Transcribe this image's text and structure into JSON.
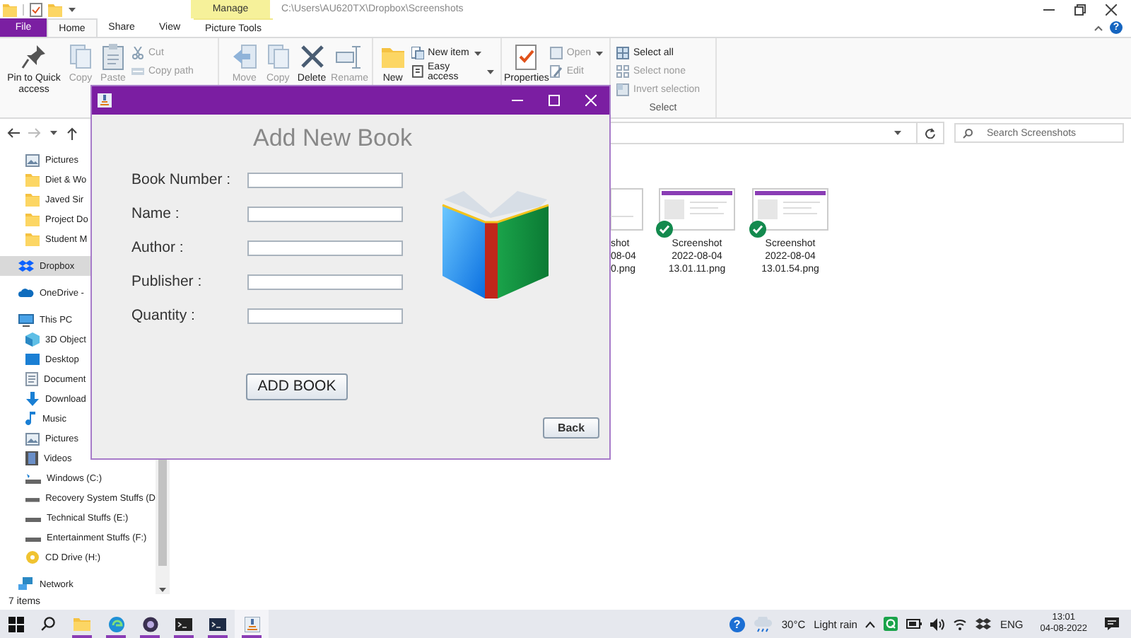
{
  "explorer": {
    "context_tab": "Manage",
    "path": "C:\\Users\\AU620TX\\Dropbox\\Screenshots",
    "tabs": [
      {
        "label": "File",
        "kind": "file",
        "selected": false
      },
      {
        "label": "Home",
        "kind": "tab",
        "selected": true
      },
      {
        "label": "Share",
        "kind": "tab",
        "selected": false
      },
      {
        "label": "View",
        "kind": "tab",
        "selected": false
      },
      {
        "label": "Picture Tools",
        "kind": "context",
        "selected": false
      }
    ],
    "help_button": "?",
    "ribbon": [
      {
        "large": [
          {
            "label": "Pin to Quick access",
            "disabled": false
          },
          {
            "label": "Copy",
            "disabled": true
          },
          {
            "label": "Paste",
            "disabled": true
          }
        ],
        "small": [
          {
            "label": "Cut",
            "disabled": true,
            "dropdown": false
          },
          {
            "label": "Copy path",
            "disabled": true,
            "dropdown": false
          }
        ]
      },
      {
        "large": [
          {
            "label": "Move",
            "disabled": true
          },
          {
            "label": "Copy",
            "disabled": true
          },
          {
            "label": "Delete",
            "disabled": false
          },
          {
            "label": "Rename",
            "disabled": true
          }
        ]
      },
      {
        "large": [
          {
            "label": "New",
            "disabled": false
          }
        ],
        "small": [
          {
            "label": "New item",
            "disabled": false,
            "dropdown": true
          },
          {
            "label": "Easy access",
            "disabled": false,
            "dropdown": true
          }
        ]
      },
      {
        "large": [
          {
            "label": "Properties",
            "disabled": false
          }
        ],
        "small": [
          {
            "label": "Open",
            "disabled": true,
            "dropdown": true
          },
          {
            "label": "Edit",
            "disabled": true,
            "dropdown": false
          }
        ]
      },
      {
        "label": "Select",
        "small": [
          {
            "label": "Select all",
            "disabled": false,
            "dropdown": false
          },
          {
            "label": "Select none",
            "disabled": true,
            "dropdown": false
          },
          {
            "label": "Invert selection",
            "disabled": true,
            "dropdown": false
          }
        ]
      }
    ],
    "search": {
      "placeholder": "Search Screenshots"
    },
    "nav": [
      {
        "children": [
          {
            "label": "Pictures",
            "selected": false
          },
          {
            "label": "Diet & Wo",
            "selected": false
          },
          {
            "label": "Javed Sir",
            "selected": false
          },
          {
            "label": "Project Do",
            "selected": false
          },
          {
            "label": "Student M",
            "selected": false
          }
        ]
      },
      {
        "label": "Dropbox",
        "selected": true
      },
      {
        "label": "OneDrive -",
        "selected": false
      },
      {
        "label": "This PC",
        "selected": false,
        "children": [
          {
            "label": "3D Object",
            "selected": false
          },
          {
            "label": "Desktop",
            "selected": false
          },
          {
            "label": "Document",
            "selected": false
          },
          {
            "label": "Download",
            "selected": false
          },
          {
            "label": "Music",
            "selected": false
          },
          {
            "label": "Pictures",
            "selected": false
          },
          {
            "label": "Videos",
            "selected": false
          },
          {
            "label": "Windows (C:)",
            "selected": false
          },
          {
            "label": "Recovery System Stuffs (D",
            "selected": false
          },
          {
            "label": "Technical Stuffs (E:)",
            "selected": false
          },
          {
            "label": "Entertainment Stuffs (F:)",
            "selected": false
          },
          {
            "label": "CD Drive (H:)",
            "selected": false
          }
        ]
      },
      {
        "label": "Network",
        "selected": false
      }
    ],
    "files": [
      {
        "kind": "partial",
        "lines": [
          "shot",
          "08-04",
          "0.png"
        ]
      },
      {
        "kind": "tile",
        "lines": [
          "Screenshot",
          "2022-08-04",
          "13.01.11.png"
        ],
        "synced": true
      },
      {
        "kind": "tile",
        "lines": [
          "Screenshot",
          "2022-08-04",
          "13.01.54.png"
        ],
        "synced": true
      }
    ],
    "status": "7 items"
  },
  "dialog": {
    "title": "Add New Book",
    "fields": [
      {
        "label": "Book Number :"
      },
      {
        "label": "Name :"
      },
      {
        "label": "Author :"
      },
      {
        "label": "Publisher :"
      },
      {
        "label": "Quantity :"
      }
    ],
    "primary_button": "ADD BOOK",
    "back_button": "Back"
  },
  "taskbar": {
    "help_glyph": "?",
    "temperature": "30°C",
    "weather": "Light rain",
    "language": "ENG",
    "time": "13:01",
    "date": "04-08-2022"
  }
}
